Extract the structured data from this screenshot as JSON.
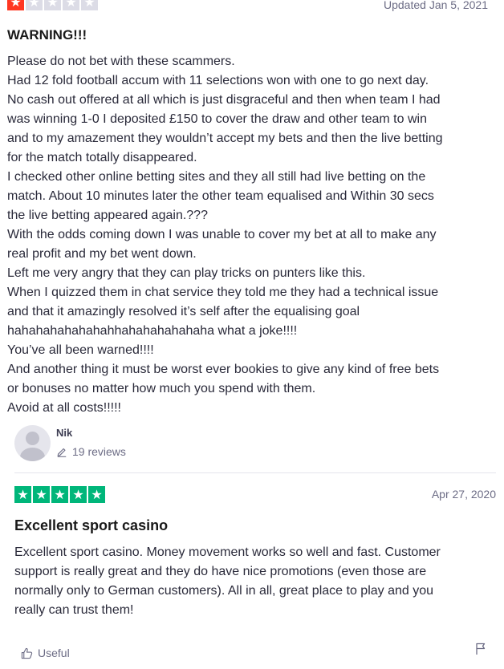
{
  "review1": {
    "stars": [
      {
        "color": "red",
        "glyph": "★"
      },
      {
        "color": "grey",
        "glyph": "★"
      },
      {
        "color": "grey",
        "glyph": "★"
      },
      {
        "color": "grey",
        "glyph": "★"
      },
      {
        "color": "grey",
        "glyph": "★"
      }
    ],
    "date": "Updated Jan 5, 2021",
    "title": "WARNING!!!",
    "lines": [
      "Please do not bet with these scammers.",
      "Had 12 fold football accum with 11 selections won with one to go next day.",
      "No cash out offered at all which is just disgraceful and then when team I had",
      "was winning 1-0 I deposited £150 to cover the draw and other team to win",
      "and to my amazement they wouldn’t accept my bets and then the live betting",
      "for the match totally disappeared.",
      "I checked other online betting sites and they all still had live betting on the",
      "match. About 10 minutes later the other team equalised and Within 30 secs",
      "the live betting appeared again.???",
      "With the odds coming down I was unable to cover my bet at all to make any",
      "real profit and my bet went down.",
      "Left me very angry that they can play tricks on punters like this.",
      "When I quizzed them in chat service they told me they had a technical issue",
      "and that it amazingly resolved it’s self after the equalising goal",
      "hahahahahahahahhahahahahahaha what a joke!!!!",
      "You’ve all been warned!!!!",
      "And another thing it must be worst ever bookies to give any kind of free bets",
      "or bonuses no matter how much you spend with them.",
      "Avoid at all costs!!!!!"
    ]
  },
  "reviewer": {
    "name": "Nik",
    "reviews_count": "19 reviews",
    "edit_icon": "pencil-icon",
    "avatar_icon": "user-silhouette-icon"
  },
  "review2": {
    "stars": [
      {
        "color": "green",
        "glyph": "★"
      },
      {
        "color": "green",
        "glyph": "★"
      },
      {
        "color": "green",
        "glyph": "★"
      },
      {
        "color": "green",
        "glyph": "★"
      },
      {
        "color": "green",
        "glyph": "★"
      }
    ],
    "date": "Apr 27, 2020",
    "title": "Excellent sport casino",
    "lines": [
      "Excellent sport casino. Money movement works so well and fast. Customer",
      "support is really great and they do have nice promotions (even those are",
      "normally only to German customers). All in all, great place to play and you",
      "really can trust them!"
    ]
  },
  "footer": {
    "useful_label": "Useful",
    "useful_icon": "thumbs-up-icon",
    "flag_icon": "flag-icon"
  },
  "colors": {
    "star_red": "#ff3722",
    "star_green": "#00b67a",
    "star_empty": "#dcdce6",
    "muted_text": "#6c6c85"
  }
}
